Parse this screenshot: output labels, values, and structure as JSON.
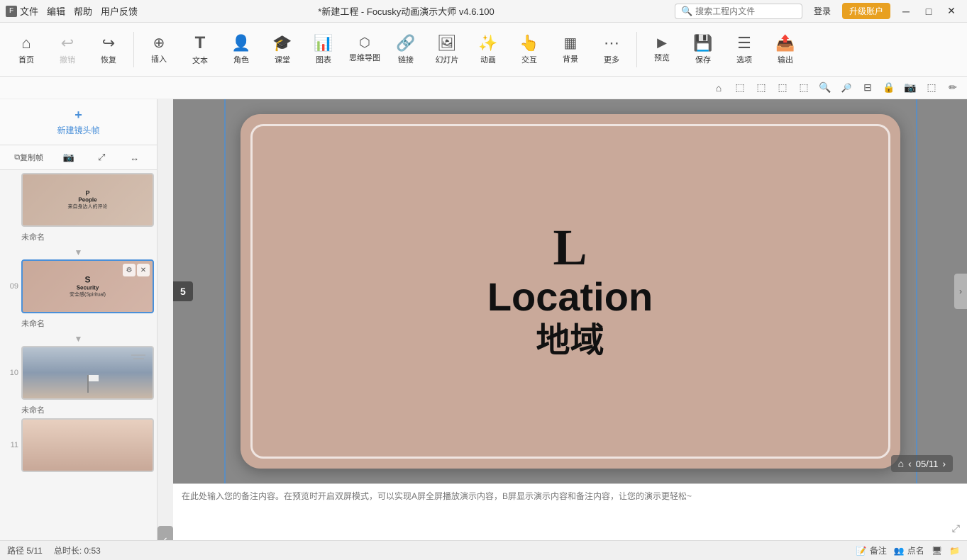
{
  "titlebar": {
    "icon": "🎬",
    "menu": [
      "文件",
      "编辑",
      "帮助",
      "用户反馈"
    ],
    "title": "*新建工程 - Focusky动画演示大师  v4.6.100",
    "search_placeholder": "搜索工程内文件",
    "login_label": "登录",
    "upgrade_label": "升级账户",
    "controls": [
      "─",
      "□",
      "✕"
    ]
  },
  "toolbar": {
    "items": [
      {
        "id": "home",
        "icon": "⌂",
        "label": "首页"
      },
      {
        "id": "undo",
        "icon": "↩",
        "label": "撤销"
      },
      {
        "id": "redo",
        "icon": "↪",
        "label": "恢复"
      },
      {
        "id": "insert",
        "icon": "⊕",
        "label": "插入"
      },
      {
        "id": "text",
        "icon": "T",
        "label": "文本"
      },
      {
        "id": "role",
        "icon": "👤",
        "label": "角色"
      },
      {
        "id": "class",
        "icon": "🎓",
        "label": "课堂"
      },
      {
        "id": "chart",
        "icon": "📊",
        "label": "图表"
      },
      {
        "id": "mindmap",
        "icon": "🌐",
        "label": "思维导图"
      },
      {
        "id": "link",
        "icon": "🔗",
        "label": "链接"
      },
      {
        "id": "slideshow",
        "icon": "🖼",
        "label": "幻灯片"
      },
      {
        "id": "animate",
        "icon": "✨",
        "label": "动画"
      },
      {
        "id": "interact",
        "icon": "👆",
        "label": "交互"
      },
      {
        "id": "background",
        "icon": "🖼",
        "label": "背景"
      },
      {
        "id": "more",
        "icon": "⋯",
        "label": "更多"
      },
      {
        "id": "preview",
        "icon": "▶",
        "label": "预览"
      },
      {
        "id": "save",
        "icon": "💾",
        "label": "保存"
      },
      {
        "id": "options",
        "icon": "☰",
        "label": "选项"
      },
      {
        "id": "export",
        "icon": "📤",
        "label": "输出"
      }
    ]
  },
  "subtoolbar": {
    "buttons": [
      "⌂",
      "⬚",
      "⬚",
      "⬚",
      "⬚",
      "🔍+",
      "🔍-",
      "⊟",
      "🔒",
      "📷",
      "⬚",
      "✏"
    ]
  },
  "sidebar": {
    "new_frame_label": "新建镜头帧",
    "controls": [
      "复制帧",
      "📷",
      "⤢",
      "↔"
    ],
    "slides": [
      {
        "num": "",
        "label": "未命名",
        "type": "people",
        "thumb_s": "P",
        "thumb_title": "People",
        "thumb_sub": "来自身边人的评论"
      },
      {
        "num": "09",
        "label": "未命名",
        "type": "security",
        "active": true,
        "thumb_s": "S",
        "thumb_title": "Security",
        "thumb_sub": "安全感(Spiritual)"
      },
      {
        "num": "10",
        "label": "未命名",
        "type": "landscape"
      },
      {
        "num": "11",
        "label": "",
        "type": "gradient"
      }
    ]
  },
  "canvas": {
    "slide_number": "5",
    "letter": "L",
    "location_en": "Location",
    "location_zh": "地域",
    "progress": "05/11"
  },
  "notes": {
    "placeholder": "在此处输入您的备注内容。在预览时开启双屏模式，可以实现A屏全屏播放演示内容，B屏显示演示内容和备注内容，让您的演示更轻松~"
  },
  "statusbar": {
    "path": "路径 5/11",
    "duration": "总时长: 0:53",
    "actions": [
      "备注",
      "点名",
      "⬚",
      "⬚"
    ]
  }
}
